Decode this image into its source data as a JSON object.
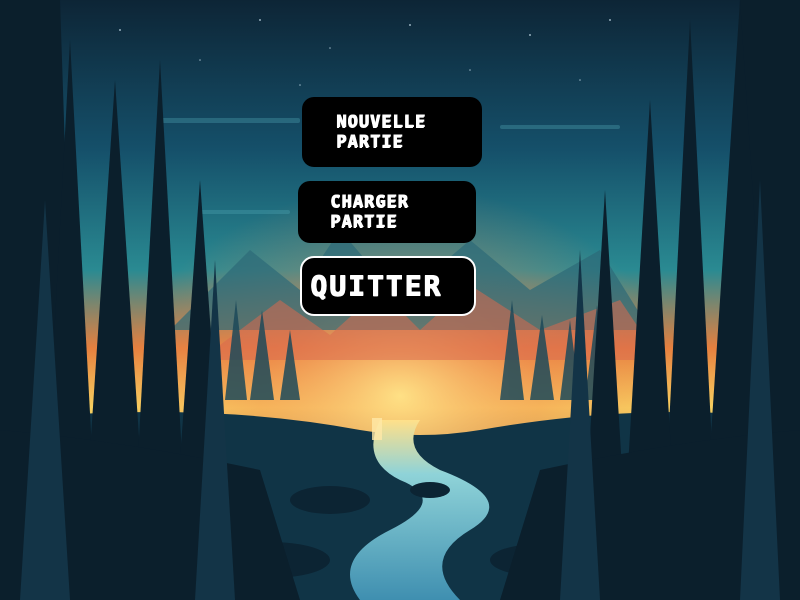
{
  "menu": {
    "new_game_label": "NOUVELLE\nPARTIE",
    "load_game_label": "CHARGER\nPARTIE",
    "quit_label": "QUITTER"
  },
  "colors": {
    "sky_top": "#0d2a3d",
    "sky_mid": "#1f6b7a",
    "horizon": "#f6c35a",
    "sunset": "#e86a4a",
    "forest_dark": "#0a1c2a",
    "river": "#5fb8d0",
    "button_bg": "#000000",
    "button_text": "#ffffff"
  }
}
